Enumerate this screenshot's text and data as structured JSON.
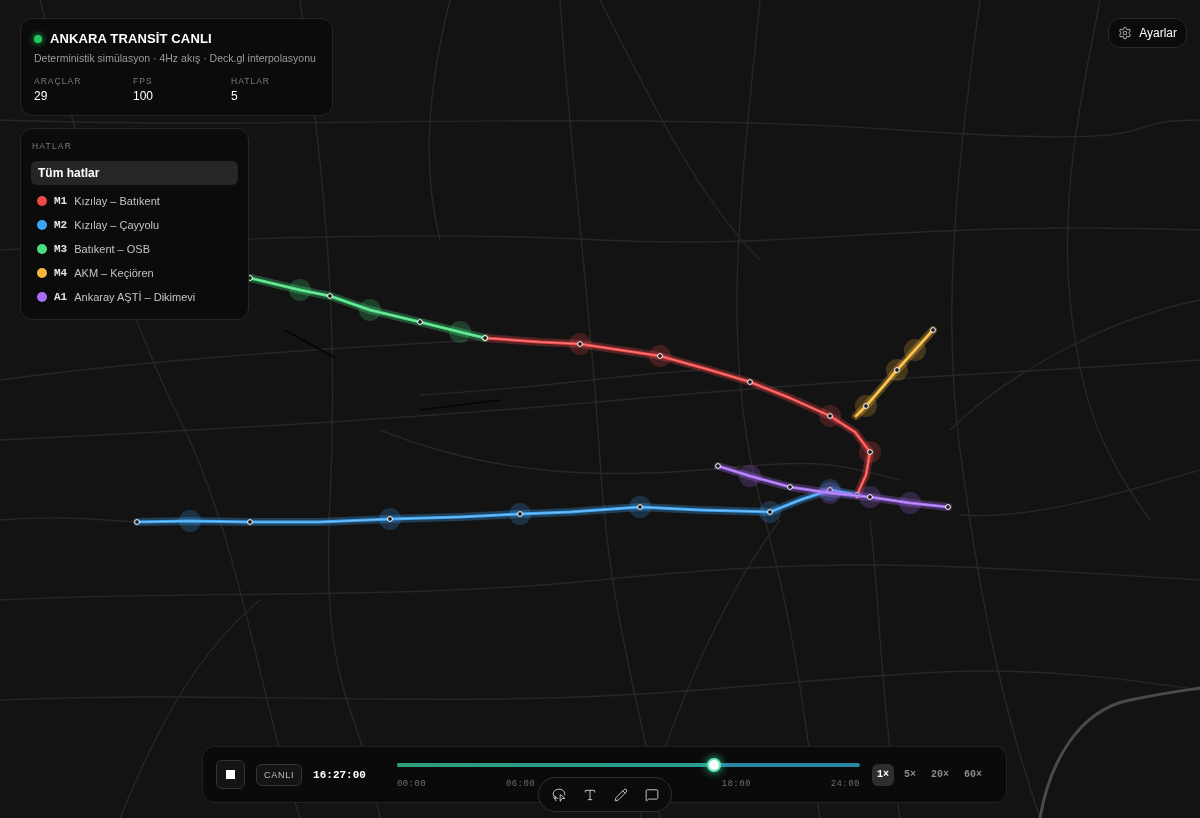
{
  "header": {
    "title": "ANKARA TRANSİT CANLI",
    "subtitle": "Deterministik simülasyon · 4Hz akış · Deck.gl interpolasyonu",
    "stats": [
      {
        "label": "ARAÇLAR",
        "value": "29"
      },
      {
        "label": "FPS",
        "value": "100"
      },
      {
        "label": "HATLAR",
        "value": "5"
      }
    ]
  },
  "lines_panel": {
    "heading": "HATLAR",
    "all": {
      "label": "Tüm hatlar",
      "selected": true
    },
    "lines": [
      {
        "code": "M1",
        "name": "Kızılay – Batıkent",
        "color": "#f04848",
        "selected": false
      },
      {
        "code": "M2",
        "name": "Kızılay – Çayyolu",
        "color": "#3ea5f4",
        "selected": false
      },
      {
        "code": "M3",
        "name": "Batıkent – OSB",
        "color": "#4ade80",
        "selected": false
      },
      {
        "code": "M4",
        "name": "AKM – Keçiören",
        "color": "#f5b83d",
        "selected": false
      },
      {
        "code": "A1",
        "name": "Ankaray AŞTİ – Dikimevi",
        "color": "#a66cf2",
        "selected": false
      }
    ]
  },
  "settings_button": {
    "label": "Ayarlar"
  },
  "playback": {
    "playing": true,
    "live_label": "CANLI",
    "time": "16:27:00",
    "level": 0.685,
    "ticks": [
      "00:00",
      "06:00",
      "18:00",
      "24:00"
    ],
    "speeds": [
      {
        "label": "1×",
        "selected": true
      },
      {
        "label": "5×",
        "selected": false
      },
      {
        "label": "20×",
        "selected": false
      },
      {
        "label": "60×",
        "selected": false
      }
    ]
  },
  "toolbar": {
    "tools": [
      {
        "kind": "lasso"
      },
      {
        "kind": "text"
      },
      {
        "kind": "pencil"
      },
      {
        "kind": "comment"
      }
    ]
  }
}
